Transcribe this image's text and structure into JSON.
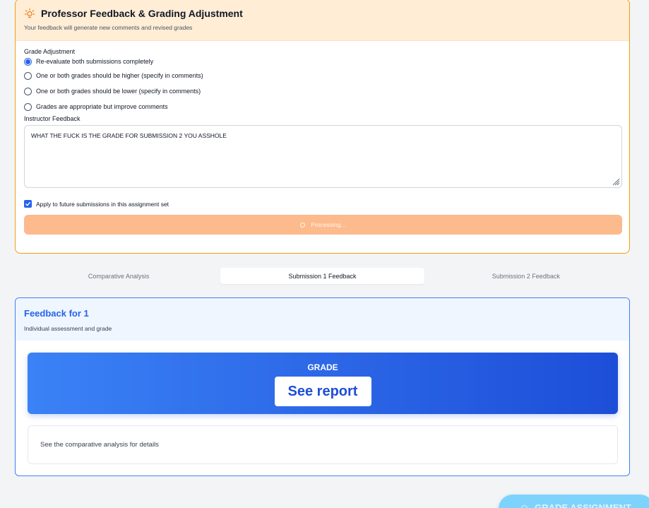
{
  "professor_panel": {
    "title": "Professor Feedback & Grading Adjustment",
    "subtitle": "Your feedback will generate new comments and revised grades",
    "grade_adjustment_label": "Grade Adjustment",
    "options": [
      {
        "label": "Re-evaluate both submissions completely",
        "selected": true
      },
      {
        "label": "One or both grades should be higher (specify in comments)",
        "selected": false
      },
      {
        "label": "One or both grades should be lower (specify in comments)",
        "selected": false
      },
      {
        "label": "Grades are appropriate but improve comments",
        "selected": false
      }
    ],
    "instructor_feedback_label": "Instructor Feedback",
    "instructor_feedback_value": "WHAT THE FUCK IS THE GRADE FOR SUBMISSION 2 YOU ASSHOLE",
    "apply_future_label": "Apply to future submissions in this assignment set",
    "apply_future_checked": true,
    "processing_label": "Processing..."
  },
  "tabs": [
    {
      "label": "Comparative Analysis",
      "active": false
    },
    {
      "label": "Submission 1 Feedback",
      "active": true
    },
    {
      "label": "Submission 2 Feedback",
      "active": false
    }
  ],
  "feedback_card": {
    "title": "Feedback for 1",
    "subtitle": "Individual assessment and grade",
    "grade_label": "GRADE",
    "grade_value": "See report",
    "details_text": "See the comparative analysis for details"
  },
  "grade_assignment_button": {
    "label": "GRADE ASSIGNMENT"
  },
  "colors": {
    "accent_orange": "#f59e0b",
    "header_orange_bg": "#ffedd5",
    "processing_orange": "#fdba8c",
    "accent_blue": "#2563eb",
    "grade_gradient_start": "#3b82f6",
    "grade_gradient_end": "#1d4ed8",
    "grade_button_bg": "#7dd3fc"
  }
}
